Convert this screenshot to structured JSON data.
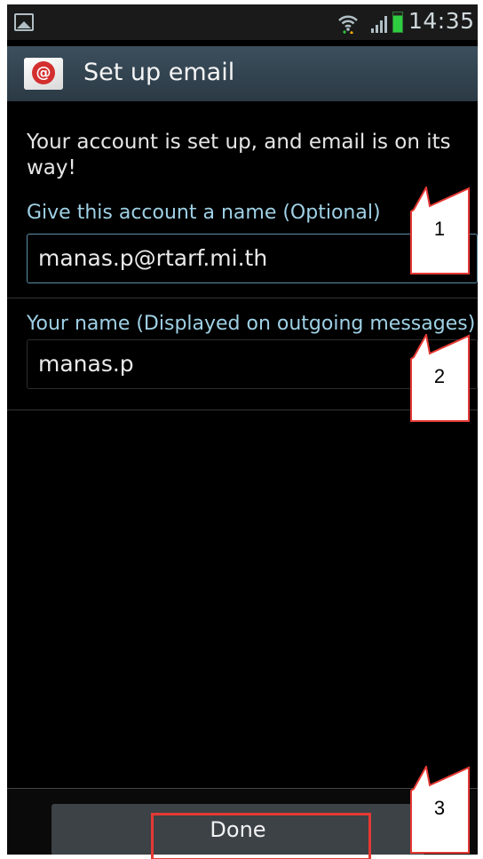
{
  "status_bar": {
    "time": "14:35",
    "icons": [
      "image-notification-icon",
      "wifi-icon",
      "signal-icon",
      "battery-icon"
    ]
  },
  "action_bar": {
    "title": "Set up email",
    "icon": "email-app-icon"
  },
  "content": {
    "intro": "Your account is set up, and email is on its way!",
    "account_name": {
      "label": "Give this account a name (Optional)",
      "value": "manas.p@rtarf.mi.th"
    },
    "your_name": {
      "label": "Your name (Displayed on outgoing messages)",
      "value": "manas.p"
    }
  },
  "footer": {
    "done_label": "Done"
  },
  "annotations": {
    "callout_1": "1",
    "callout_2": "2",
    "callout_3": "3"
  },
  "colors": {
    "background": "#000000",
    "action_bar": "#34454f",
    "label_accent": "#9fd1e6",
    "annotation_red": "#e53935"
  }
}
